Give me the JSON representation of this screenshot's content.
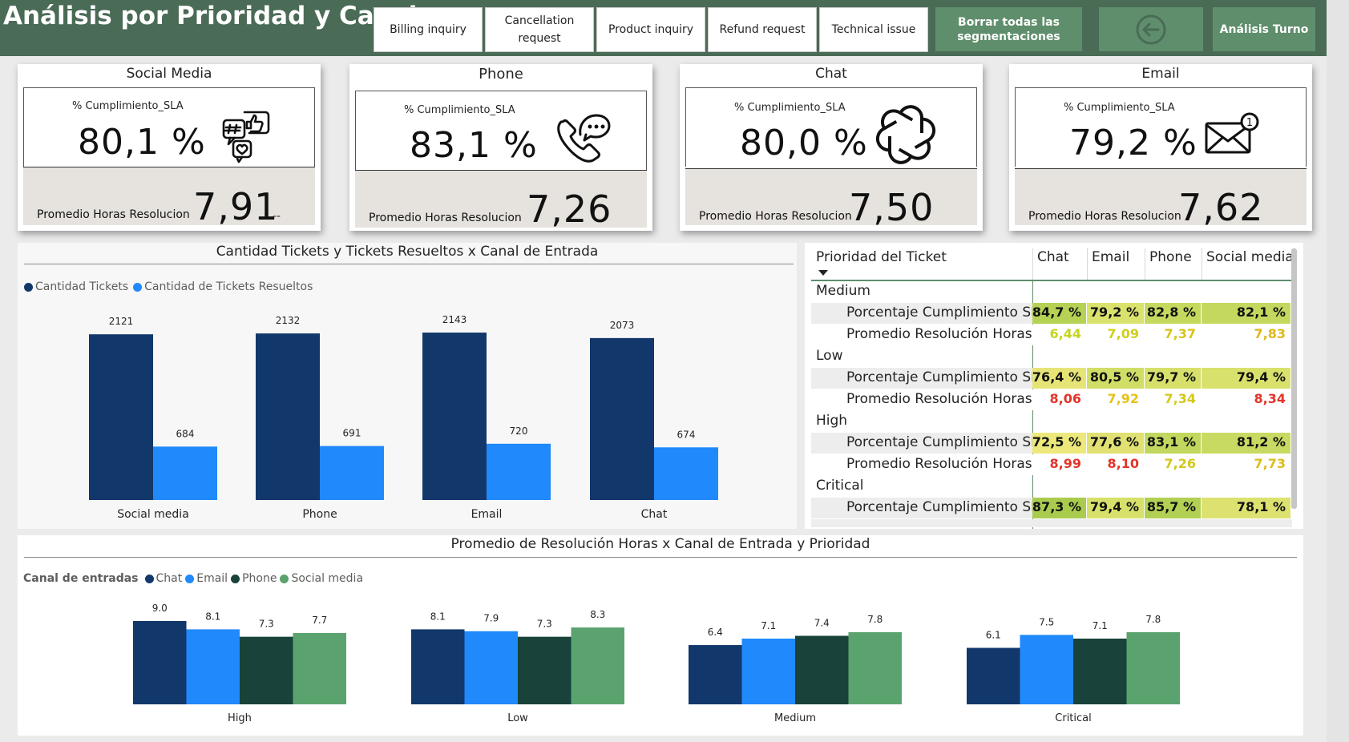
{
  "header": {
    "title": "Análisis por Prioridad y Canal",
    "slicers": [
      {
        "label": "Billing inquiry"
      },
      {
        "label": "Cancellation request"
      },
      {
        "label": "Product inquiry"
      },
      {
        "label": "Refund request"
      },
      {
        "label": "Technical issue"
      }
    ],
    "clear_button": "Borrar todas las segmentaciones",
    "back_icon": "arrow-left-circle-icon",
    "shift_button": "Análisis Turno"
  },
  "kpi_cards": [
    {
      "channel": "Social Media",
      "sla_label": "% Cumplimiento_SLA",
      "sla_value": "80,1 %",
      "avg_label": "Promedio Horas Resolucion",
      "avg_value": "7,91",
      "extra": "--",
      "icon": "social-media-icon"
    },
    {
      "channel": "Phone",
      "sla_label": "% Cumplimiento_SLA",
      "sla_value": "83,1 %",
      "avg_label": "Promedio Horas Resolucion",
      "avg_value": "7,26",
      "extra": "",
      "icon": "phone-chat-icon"
    },
    {
      "channel": "Chat",
      "sla_label": "% Cumplimiento_SLA",
      "sla_value": "80,0 %",
      "avg_label": "Promedio Horas Resolucion",
      "avg_value": "7,50",
      "extra": "",
      "icon": "openai-knot-icon"
    },
    {
      "channel": "Email",
      "sla_label": "% Cumplimiento_SLA",
      "sla_value": "79,2 %",
      "avg_label": "Promedio Horas Resolucion",
      "avg_value": "7,62",
      "extra": "",
      "icon": "envelope-notification-icon"
    }
  ],
  "tickets_chart": {
    "title": "Cantidad Tickets y Tickets Resueltos x Canal de Entrada",
    "legend": [
      "Cantidad Tickets",
      "Cantidad de Tickets Resueltos"
    ],
    "colors": {
      "total": "#12386b",
      "resolved": "#2089fb"
    }
  },
  "avg_chart": {
    "title": "Promedio de Resolución Horas x Canal de Entrada y Prioridad",
    "legend_title": "Canal de entradas",
    "legend": [
      "Chat",
      "Email",
      "Phone",
      "Social media"
    ],
    "colors": {
      "Chat": "#12386b",
      "Email": "#2089fb",
      "Phone": "#18423a",
      "Social media": "#5aa36e"
    }
  },
  "chart_data": [
    {
      "type": "bar",
      "title": "Cantidad Tickets y Tickets Resueltos x Canal de Entrada",
      "categories": [
        "Social media",
        "Phone",
        "Email",
        "Chat"
      ],
      "series": [
        {
          "name": "Cantidad Tickets",
          "values": [
            2121,
            2132,
            2143,
            2073
          ]
        },
        {
          "name": "Cantidad de Tickets Resueltos",
          "values": [
            684,
            691,
            720,
            674
          ]
        }
      ],
      "ylim": [
        0,
        2400
      ],
      "legend_position": "top-left",
      "grid": false
    },
    {
      "type": "bar",
      "title": "Promedio de Resolución Horas x Canal de Entrada y Prioridad",
      "categories": [
        "High",
        "Low",
        "Medium",
        "Critical"
      ],
      "series": [
        {
          "name": "Chat",
          "values": [
            9.0,
            8.1,
            6.4,
            6.1
          ]
        },
        {
          "name": "Email",
          "values": [
            8.1,
            7.9,
            7.1,
            7.5
          ]
        },
        {
          "name": "Phone",
          "values": [
            7.3,
            7.3,
            7.4,
            7.1
          ]
        },
        {
          "name": "Social media",
          "values": [
            7.7,
            8.3,
            7.8,
            7.8
          ]
        }
      ],
      "ylim": [
        0,
        9
      ],
      "legend_title": "Canal de entradas",
      "legend_position": "top-left",
      "grid": false
    }
  ],
  "matrix": {
    "header": "Prioridad del Ticket",
    "columns": [
      "Chat",
      "Email",
      "Phone",
      "Social media"
    ],
    "groups": [
      {
        "name": "Medium",
        "rows": [
          {
            "label": "Porcentaje Cumplimiento SLA",
            "values": [
              "84,7 %",
              "79,2 %",
              "82,8 %",
              "82,1 %"
            ],
            "colors": [
              "#b5d255",
              "#d9e26c",
              "#c6d95f",
              "#c4d85f"
            ],
            "text": [
              "#111111",
              "#111111",
              "#111111",
              "#111111"
            ]
          },
          {
            "label": "Promedio Resolución Horas",
            "values": [
              "6,44",
              "7,09",
              "7,37",
              "7,83"
            ],
            "colors": [
              "#ffffff",
              "#ffffff",
              "#ffffff",
              "#ffffff"
            ],
            "text": [
              "#c6d41a",
              "#d1cf1a",
              "#d8c51a",
              "#e0b81a"
            ]
          }
        ]
      },
      {
        "name": "Low",
        "rows": [
          {
            "label": "Porcentaje Cumplimiento SLA",
            "values": [
              "76,4 %",
              "80,5 %",
              "79,7 %",
              "79,4 %"
            ],
            "colors": [
              "#e7e477",
              "#d0de67",
              "#d6e06b",
              "#d8e16c"
            ],
            "text": [
              "#111111",
              "#111111",
              "#111111",
              "#111111"
            ]
          },
          {
            "label": "Promedio Resolución Horas",
            "values": [
              "8,06",
              "7,92",
              "7,34",
              "8,34"
            ],
            "colors": [
              "#ffffff",
              "#ffffff",
              "#ffffff",
              "#ffffff"
            ],
            "text": [
              "#e2342a",
              "#e6c21a",
              "#d3c81a",
              "#e2342a"
            ]
          }
        ]
      },
      {
        "name": "High",
        "rows": [
          {
            "label": "Porcentaje Cumplimiento SLA",
            "values": [
              "72,5 %",
              "77,6 %",
              "83,1 %",
              "81,2 %"
            ],
            "colors": [
              "#ece87b",
              "#e0e172",
              "#c1d75e",
              "#c9da62"
            ],
            "text": [
              "#111111",
              "#111111",
              "#111111",
              "#111111"
            ]
          },
          {
            "label": "Promedio Resolución Horas",
            "values": [
              "8,99",
              "8,10",
              "7,26",
              "7,73"
            ],
            "colors": [
              "#ffffff",
              "#ffffff",
              "#ffffff",
              "#ffffff"
            ],
            "text": [
              "#e2342a",
              "#e2342a",
              "#d3c81a",
              "#dcbd1a"
            ]
          }
        ]
      },
      {
        "name": "Critical",
        "rows": [
          {
            "label": "Porcentaje Cumplimiento SLA",
            "values": [
              "87,3 %",
              "79,4 %",
              "85,7 %",
              "78,1 %"
            ],
            "colors": [
              "#a9cc4f",
              "#d7e06b",
              "#b2d053",
              "#dde16f"
            ],
            "text": [
              "#111111",
              "#111111",
              "#111111",
              "#111111"
            ]
          }
        ]
      }
    ]
  }
}
